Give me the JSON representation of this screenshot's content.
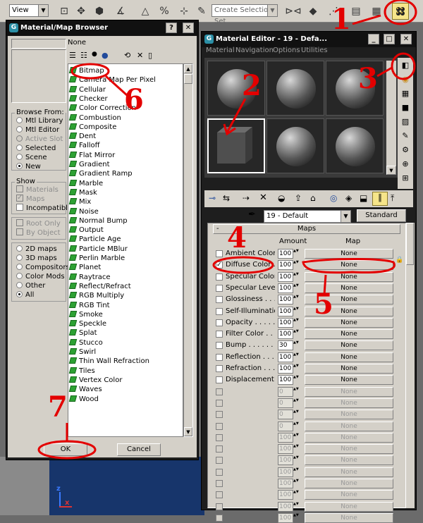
{
  "toolbar": {
    "view_select": "View",
    "selection_set_placeholder": "Create Selection Set"
  },
  "browser": {
    "title": "Material/Map Browser",
    "name_field": "None",
    "browse_from": {
      "title": "Browse From:",
      "options": [
        "Mtl Library",
        "Mtl Editor",
        "Active Slot",
        "Selected",
        "Scene",
        "New"
      ]
    },
    "show": {
      "title": "Show",
      "options": [
        "Materials",
        "Maps",
        "Incompatible"
      ]
    },
    "root_options": [
      "Root Only",
      "By Object"
    ],
    "map_categories": [
      "2D maps",
      "3D maps",
      "Compositors",
      "Color Mods",
      "Other",
      "All"
    ],
    "maps": [
      "Bitmap",
      "Camera Map Per Pixel",
      "Cellular",
      "Checker",
      "Color Correction",
      "Combustion",
      "Composite",
      "Dent",
      "Falloff",
      "Flat Mirror",
      "Gradient",
      "Gradient Ramp",
      "Marble",
      "Mask",
      "Mix",
      "Noise",
      "Normal Bump",
      "Output",
      "Particle Age",
      "Particle MBlur",
      "Perlin Marble",
      "Planet",
      "Raytrace",
      "Reflect/Refract",
      "RGB Multiply",
      "RGB Tint",
      "Smoke",
      "Speckle",
      "Splat",
      "Stucco",
      "Swirl",
      "Thin Wall Refraction",
      "Tiles",
      "Vertex Color",
      "Waves",
      "Wood"
    ],
    "ok_label": "OK",
    "cancel_label": "Cancel"
  },
  "editor": {
    "title": "Material Editor - 19 - Defa...",
    "menu": [
      "Material",
      "Navigation",
      "Options",
      "Utilities"
    ],
    "material_name": "19 - Default",
    "material_type": "Standard",
    "maps_rollout": {
      "title": "Maps",
      "col_amount": "Amount",
      "col_map": "Map",
      "rows": [
        {
          "label": "Ambient Color . .",
          "amount": "100",
          "map": "None"
        },
        {
          "label": "Diffuse Color . .",
          "amount": "100",
          "map": "None"
        },
        {
          "label": "Specular Color . .",
          "amount": "100",
          "map": "None"
        },
        {
          "label": "Specular Level . .",
          "amount": "100",
          "map": "None"
        },
        {
          "label": "Glossiness . . . . .",
          "amount": "100",
          "map": "None"
        },
        {
          "label": "Self-Illumination .",
          "amount": "100",
          "map": "None"
        },
        {
          "label": "Opacity . . . . . . .",
          "amount": "100",
          "map": "None"
        },
        {
          "label": "Filter Color . . . .",
          "amount": "100",
          "map": "None"
        },
        {
          "label": "Bump . . . . . . . .",
          "amount": "30",
          "map": "None"
        },
        {
          "label": "Reflection . . . . .",
          "amount": "100",
          "map": "None"
        },
        {
          "label": "Refraction . . . . .",
          "amount": "100",
          "map": "None"
        },
        {
          "label": "Displacement . . .",
          "amount": "100",
          "map": "None"
        },
        {
          "label": "",
          "amount": "0",
          "map": "None"
        },
        {
          "label": "",
          "amount": "0",
          "map": "None"
        },
        {
          "label": "",
          "amount": "0",
          "map": "None"
        },
        {
          "label": "",
          "amount": "0",
          "map": "None"
        },
        {
          "label": "",
          "amount": "100",
          "map": "None"
        },
        {
          "label": "",
          "amount": "100",
          "map": "None"
        },
        {
          "label": "",
          "amount": "100",
          "map": "None"
        },
        {
          "label": "",
          "amount": "100",
          "map": "None"
        },
        {
          "label": "",
          "amount": "100",
          "map": "None"
        },
        {
          "label": "",
          "amount": "100",
          "map": "None"
        },
        {
          "label": "",
          "amount": "100",
          "map": "None"
        },
        {
          "label": "",
          "amount": "100",
          "map": "None"
        }
      ]
    }
  },
  "annotations": {
    "numbers": [
      "1",
      "2",
      "3",
      "4",
      "5",
      "6",
      "7"
    ],
    "color": "#e30000"
  },
  "viewport": {
    "axis_x": "x",
    "axis_z": "z"
  }
}
